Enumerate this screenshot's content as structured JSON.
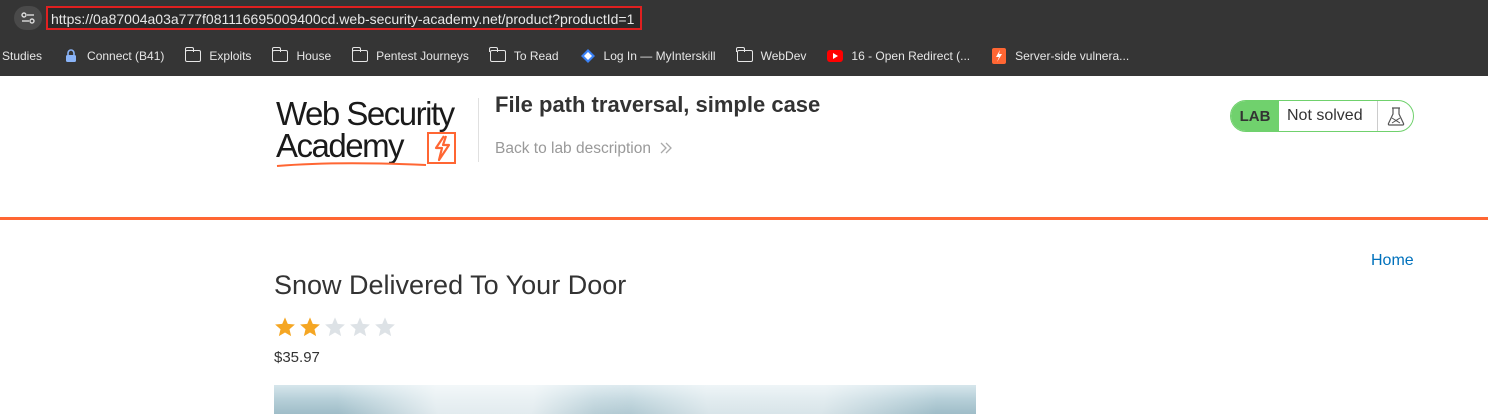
{
  "browser": {
    "url": "https://0a87004a03a777f081116695009400cd.web-security-academy.net/product?productId=1",
    "bookmarks": [
      {
        "label": "Studies",
        "icon": "none"
      },
      {
        "label": "Connect (B41)",
        "icon": "lock-icon"
      },
      {
        "label": "Exploits",
        "icon": "folder-icon"
      },
      {
        "label": "House",
        "icon": "folder-icon"
      },
      {
        "label": "Pentest Journeys",
        "icon": "folder-icon"
      },
      {
        "label": "To Read",
        "icon": "folder-icon"
      },
      {
        "label": "Log In — MyInterskill",
        "icon": "diamond-icon"
      },
      {
        "label": "WebDev",
        "icon": "folder-icon"
      },
      {
        "label": "16 - Open Redirect (...",
        "icon": "youtube-icon"
      },
      {
        "label": "Server-side vulnera...",
        "icon": "portswigger-icon"
      }
    ]
  },
  "header": {
    "logo_line1": "Web Security",
    "logo_line2": "Academy",
    "lab_title": "File path traversal, simple case",
    "back_link": "Back to lab description",
    "status_lab": "LAB",
    "status_text": "Not solved"
  },
  "content": {
    "home_link": "Home",
    "product_title": "Snow Delivered To Your Door",
    "rating": 2,
    "rating_max": 5,
    "price": "$35.97"
  },
  "colors": {
    "accent_orange": "#ff6633",
    "lab_green": "#70d16d",
    "star_filled": "#f5a623",
    "star_empty": "#dde2e6",
    "link_blue": "#0071bc"
  }
}
